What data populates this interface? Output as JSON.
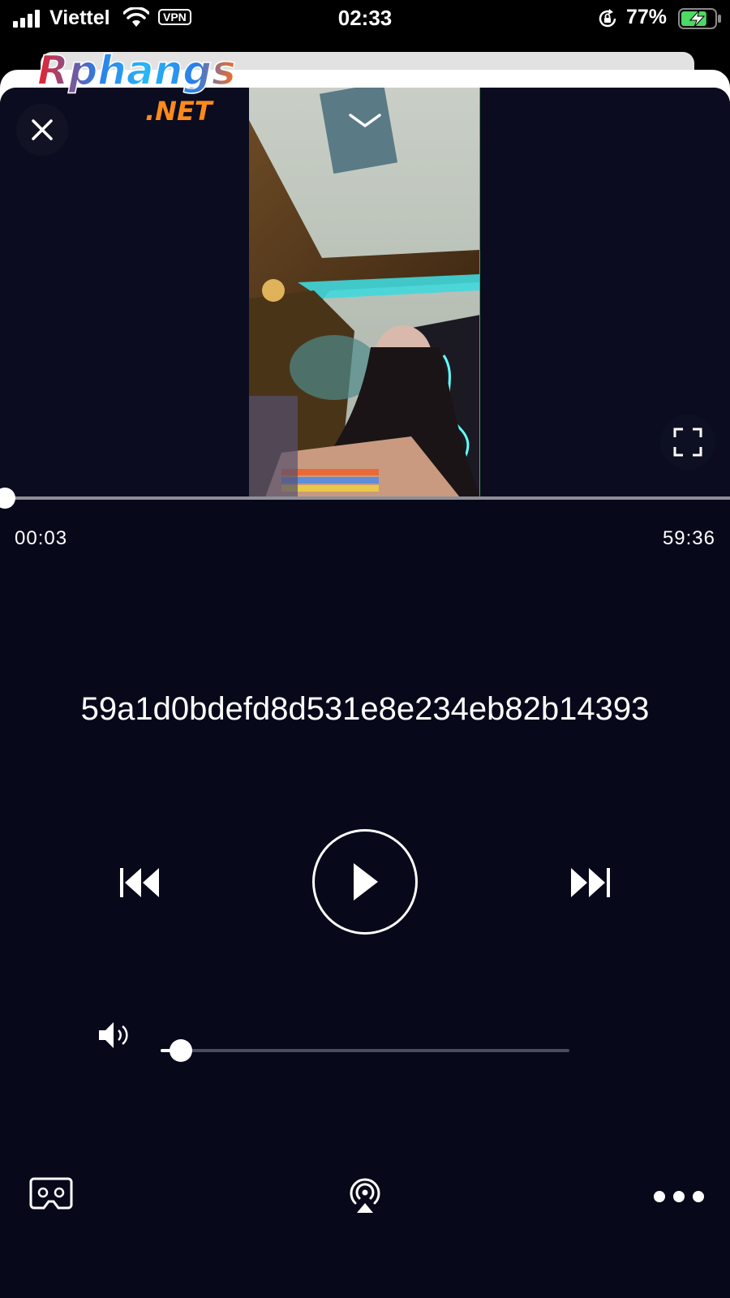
{
  "status_bar": {
    "carrier": "Viettel",
    "vpn_label": "VPN",
    "time": "02:33",
    "battery_percent": "77%",
    "battery_level": 0.77,
    "icons": [
      "signal-icon",
      "wifi-icon",
      "rotation-lock-icon",
      "battery-charging-icon"
    ]
  },
  "watermark": {
    "logo_text": "Rphangs",
    "logo_suffix": ".NET"
  },
  "player": {
    "elapsed": "00:03",
    "total": "59:36",
    "progress_fraction": 0.001,
    "title": "59a1d0bdefd8d531e8e234eb82b14393",
    "volume_fraction": 0.05,
    "controls": {
      "close": "close-icon",
      "collapse": "chevron-down-icon",
      "fullscreen": "fullscreen-icon",
      "rewind": "rewind-icon",
      "play": "play-icon",
      "forward": "fast-forward-icon",
      "volume": "speaker-icon",
      "vr": "vr-headset-icon",
      "airplay": "airplay-icon",
      "more": "more-icon"
    }
  },
  "colors": {
    "background": "#07081a",
    "accent": "#ffffff",
    "battery_green": "#4cd964"
  }
}
